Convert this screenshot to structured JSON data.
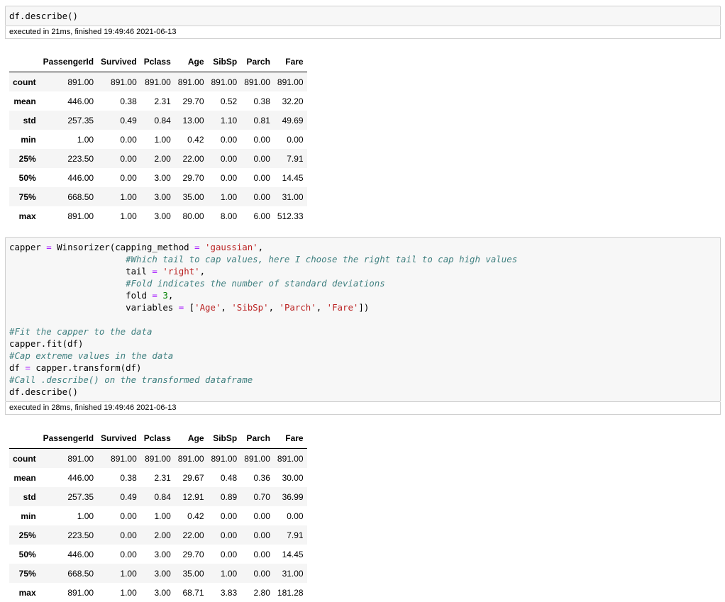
{
  "cells": [
    {
      "code_lines": [
        [
          {
            "t": "df.describe()",
            "k": ""
          }
        ]
      ],
      "exec_info": "executed in 21ms, finished 19:49:46 2021-06-13"
    },
    {
      "code_lines": [
        [
          {
            "t": "capper ",
            "k": ""
          },
          {
            "t": "=",
            "k": "o"
          },
          {
            "t": " Winsorizer(capping_method ",
            "k": ""
          },
          {
            "t": "=",
            "k": "o"
          },
          {
            "t": " ",
            "k": ""
          },
          {
            "t": "'gaussian'",
            "k": "s"
          },
          {
            "t": ",",
            "k": ""
          }
        ],
        [
          {
            "t": "                      ",
            "k": ""
          },
          {
            "t": "#Which tail to cap values, here I choose the right tail to cap high values",
            "k": "c"
          }
        ],
        [
          {
            "t": "                      tail ",
            "k": ""
          },
          {
            "t": "=",
            "k": "o"
          },
          {
            "t": " ",
            "k": ""
          },
          {
            "t": "'right'",
            "k": "s"
          },
          {
            "t": ",",
            "k": ""
          }
        ],
        [
          {
            "t": "                      ",
            "k": ""
          },
          {
            "t": "#Fold indicates the number of standard deviations",
            "k": "c"
          }
        ],
        [
          {
            "t": "                      fold ",
            "k": ""
          },
          {
            "t": "=",
            "k": "o"
          },
          {
            "t": " ",
            "k": ""
          },
          {
            "t": "3",
            "k": "n"
          },
          {
            "t": ",",
            "k": ""
          }
        ],
        [
          {
            "t": "                      variables ",
            "k": ""
          },
          {
            "t": "=",
            "k": "o"
          },
          {
            "t": " [",
            "k": ""
          },
          {
            "t": "'Age'",
            "k": "s"
          },
          {
            "t": ", ",
            "k": ""
          },
          {
            "t": "'SibSp'",
            "k": "s"
          },
          {
            "t": ", ",
            "k": ""
          },
          {
            "t": "'Parch'",
            "k": "s"
          },
          {
            "t": ", ",
            "k": ""
          },
          {
            "t": "'Fare'",
            "k": "s"
          },
          {
            "t": "])",
            "k": ""
          }
        ],
        [
          {
            "t": "",
            "k": ""
          }
        ],
        [
          {
            "t": "#Fit the capper to the data",
            "k": "c"
          }
        ],
        [
          {
            "t": "capper.fit(df)",
            "k": ""
          }
        ],
        [
          {
            "t": "#Cap extreme values in the data",
            "k": "c"
          }
        ],
        [
          {
            "t": "df ",
            "k": ""
          },
          {
            "t": "=",
            "k": "o"
          },
          {
            "t": " capper.transform(df)",
            "k": ""
          }
        ],
        [
          {
            "t": "#Call .describe() on the transformed dataframe",
            "k": "c"
          }
        ],
        [
          {
            "t": "df.describe()",
            "k": ""
          }
        ]
      ],
      "exec_info": "executed in 28ms, finished 19:49:46 2021-06-13"
    }
  ],
  "tables": [
    {
      "columns": [
        "",
        "PassengerId",
        "Survived",
        "Pclass",
        "Age",
        "SibSp",
        "Parch",
        "Fare"
      ],
      "rows": [
        {
          "index": "count",
          "values": [
            "891.00",
            "891.00",
            "891.00",
            "891.00",
            "891.00",
            "891.00",
            "891.00"
          ]
        },
        {
          "index": "mean",
          "values": [
            "446.00",
            "0.38",
            "2.31",
            "29.70",
            "0.52",
            "0.38",
            "32.20"
          ]
        },
        {
          "index": "std",
          "values": [
            "257.35",
            "0.49",
            "0.84",
            "13.00",
            "1.10",
            "0.81",
            "49.69"
          ]
        },
        {
          "index": "min",
          "values": [
            "1.00",
            "0.00",
            "1.00",
            "0.42",
            "0.00",
            "0.00",
            "0.00"
          ]
        },
        {
          "index": "25%",
          "values": [
            "223.50",
            "0.00",
            "2.00",
            "22.00",
            "0.00",
            "0.00",
            "7.91"
          ]
        },
        {
          "index": "50%",
          "values": [
            "446.00",
            "0.00",
            "3.00",
            "29.70",
            "0.00",
            "0.00",
            "14.45"
          ]
        },
        {
          "index": "75%",
          "values": [
            "668.50",
            "1.00",
            "3.00",
            "35.00",
            "1.00",
            "0.00",
            "31.00"
          ]
        },
        {
          "index": "max",
          "values": [
            "891.00",
            "1.00",
            "3.00",
            "80.00",
            "8.00",
            "6.00",
            "512.33"
          ]
        }
      ]
    },
    {
      "columns": [
        "",
        "PassengerId",
        "Survived",
        "Pclass",
        "Age",
        "SibSp",
        "Parch",
        "Fare"
      ],
      "rows": [
        {
          "index": "count",
          "values": [
            "891.00",
            "891.00",
            "891.00",
            "891.00",
            "891.00",
            "891.00",
            "891.00"
          ]
        },
        {
          "index": "mean",
          "values": [
            "446.00",
            "0.38",
            "2.31",
            "29.67",
            "0.48",
            "0.36",
            "30.00"
          ]
        },
        {
          "index": "std",
          "values": [
            "257.35",
            "0.49",
            "0.84",
            "12.91",
            "0.89",
            "0.70",
            "36.99"
          ]
        },
        {
          "index": "min",
          "values": [
            "1.00",
            "0.00",
            "1.00",
            "0.42",
            "0.00",
            "0.00",
            "0.00"
          ]
        },
        {
          "index": "25%",
          "values": [
            "223.50",
            "0.00",
            "2.00",
            "22.00",
            "0.00",
            "0.00",
            "7.91"
          ]
        },
        {
          "index": "50%",
          "values": [
            "446.00",
            "0.00",
            "3.00",
            "29.70",
            "0.00",
            "0.00",
            "14.45"
          ]
        },
        {
          "index": "75%",
          "values": [
            "668.50",
            "1.00",
            "3.00",
            "35.00",
            "1.00",
            "0.00",
            "31.00"
          ]
        },
        {
          "index": "max",
          "values": [
            "891.00",
            "1.00",
            "3.00",
            "68.71",
            "3.83",
            "2.80",
            "181.28"
          ]
        }
      ]
    }
  ]
}
